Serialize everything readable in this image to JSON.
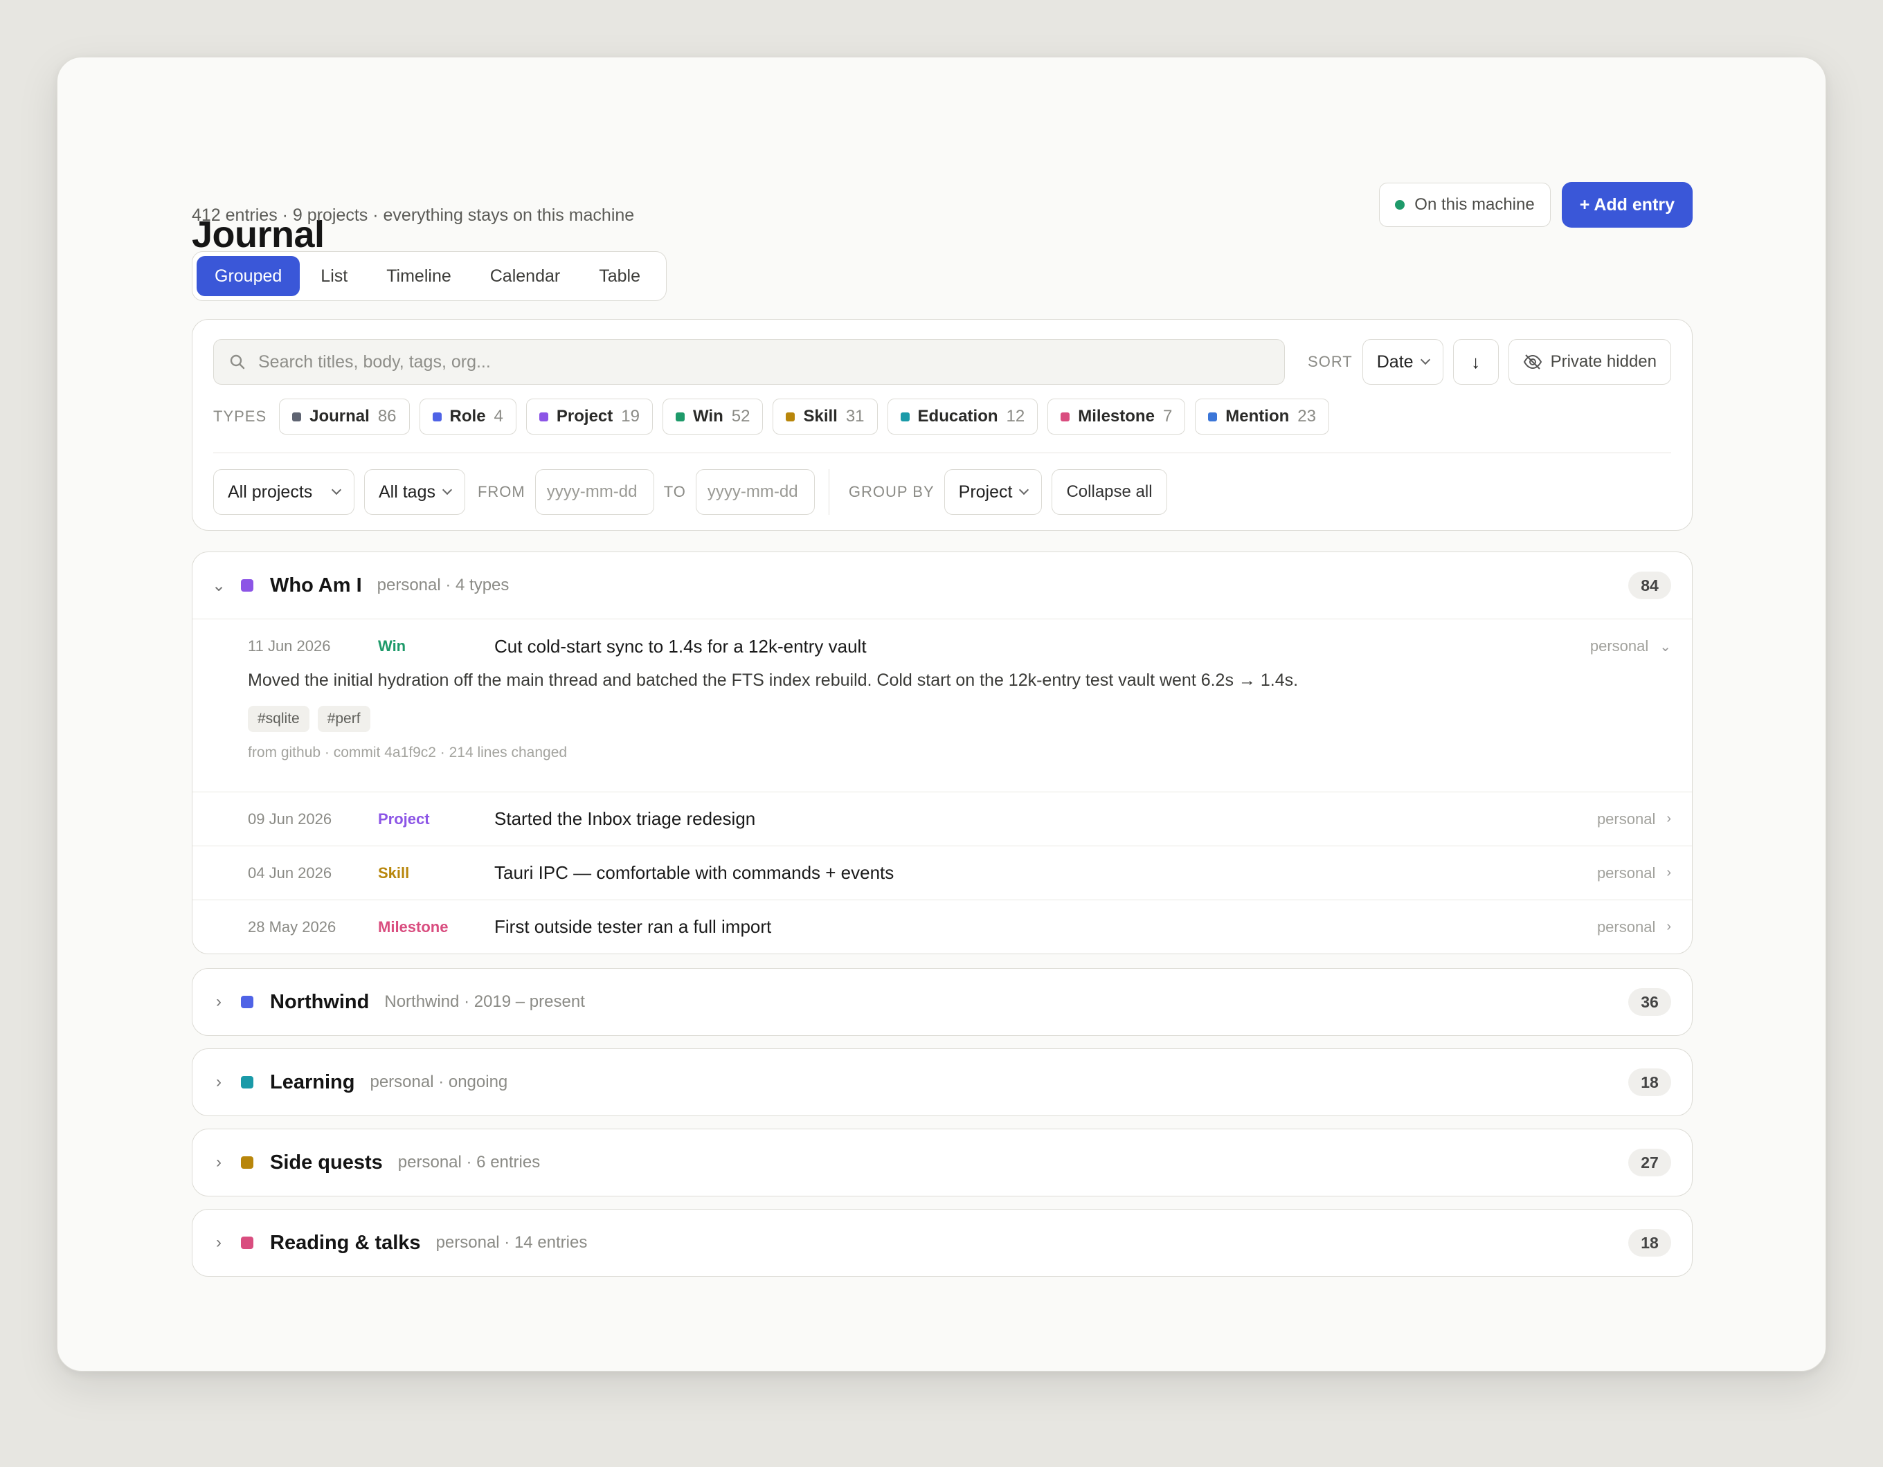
{
  "header": {
    "title": "Journal",
    "subtitle": "412 entries · 9 projects · everything stays on this machine",
    "machine_status": "On this machine",
    "add_button": "+ Add entry"
  },
  "views": {
    "tabs": [
      "Grouped",
      "List",
      "Timeline",
      "Calendar",
      "Table"
    ],
    "active": "Grouped"
  },
  "filters": {
    "search_placeholder": "Search titles, body, tags, org...",
    "sort_label": "SORT",
    "sort_value": "Date",
    "sort_direction": "↓",
    "private_toggle": "Private hidden",
    "types_label": "TYPES",
    "types": [
      {
        "name": "Journal",
        "count": "86",
        "color": "#5f6472"
      },
      {
        "name": "Role",
        "count": "4",
        "color": "#4f63e6"
      },
      {
        "name": "Project",
        "count": "19",
        "color": "#8c55e6"
      },
      {
        "name": "Win",
        "count": "52",
        "color": "#1e9a6a"
      },
      {
        "name": "Skill",
        "count": "31",
        "color": "#b8860b"
      },
      {
        "name": "Education",
        "count": "12",
        "color": "#1a9aa8"
      },
      {
        "name": "Milestone",
        "count": "7",
        "color": "#d94d7f"
      },
      {
        "name": "Mention",
        "count": "23",
        "color": "#3b76d8"
      }
    ],
    "projects_select": "All projects",
    "tags_select": "All tags",
    "from_label": "FROM",
    "from_placeholder": "yyyy-mm-dd",
    "to_label": "TO",
    "to_placeholder": "yyyy-mm-dd",
    "group_by_label": "GROUP BY",
    "group_by_value": "Project",
    "collapse_button": "Collapse all"
  },
  "groups": [
    {
      "name": "Who Am I",
      "meta": "personal · 4 types",
      "count": "84",
      "color": "#8c55e6",
      "expanded": true,
      "entries": [
        {
          "date": "11 Jun 2026",
          "type": "Win",
          "type_color": "#1e9a6a",
          "title": "Cut cold-start sync to 1.4s for a 12k-entry vault",
          "org": "personal",
          "body": "Moved the initial hydration off the main thread and batched the FTS index rebuild. Cold start on the 12k-entry test vault went 6.2s → 1.4s.",
          "tags": [
            "#sqlite",
            "#perf"
          ],
          "source": "from github · commit 4a1f9c2 · 214 lines changed"
        },
        {
          "date": "09 Jun 2026",
          "type": "Project",
          "type_color": "#8c55e6",
          "title": "Started the Inbox triage redesign",
          "org": "personal"
        },
        {
          "date": "04 Jun 2026",
          "type": "Skill",
          "type_color": "#b8860b",
          "title": "Tauri IPC — comfortable with commands + events",
          "org": "personal"
        },
        {
          "date": "28 May 2026",
          "type": "Milestone",
          "type_color": "#d94d7f",
          "title": "First outside tester ran a full import",
          "org": "personal"
        }
      ]
    },
    {
      "name": "Northwind",
      "meta": "Northwind · 2019 – present",
      "count": "36",
      "color": "#4f63e6"
    },
    {
      "name": "Learning",
      "meta": "personal · ongoing",
      "count": "18",
      "color": "#1a9aa8"
    },
    {
      "name": "Side quests",
      "meta": "personal · 6 entries",
      "count": "27",
      "color": "#b8860b"
    },
    {
      "name": "Reading & talks",
      "meta": "personal · 14 entries",
      "count": "18",
      "color": "#d94d7f"
    }
  ]
}
